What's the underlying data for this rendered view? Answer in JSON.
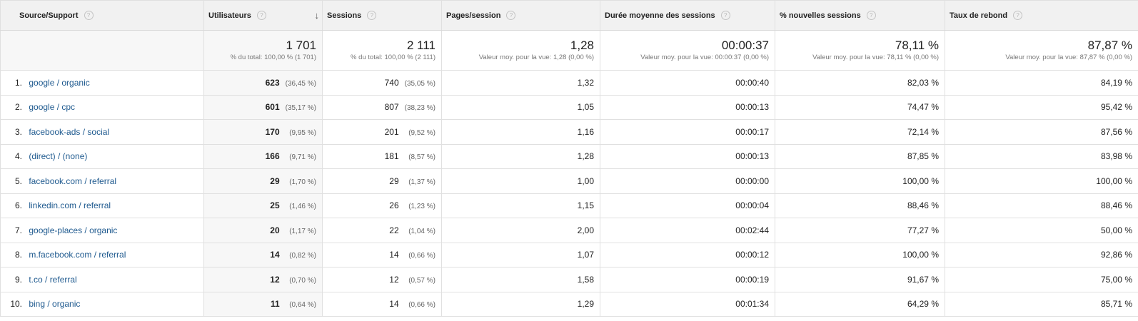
{
  "headers": {
    "source": "Source/Support",
    "users": "Utilisateurs",
    "sessions": "Sessions",
    "pages": "Pages/session",
    "duration": "Durée moyenne des sessions",
    "new_sessions": "% nouvelles sessions",
    "bounce": "Taux de rebond",
    "help_glyph": "?"
  },
  "totals": {
    "users": "1 701",
    "users_sub": "% du total: 100,00 % (1 701)",
    "sessions": "2 111",
    "sessions_sub": "% du total: 100,00 % (2 111)",
    "pages": "1,28",
    "pages_sub": "Valeur moy. pour la vue: 1,28 (0,00 %)",
    "duration": "00:00:37",
    "duration_sub": "Valeur moy. pour la vue: 00:00:37 (0,00 %)",
    "new_sessions": "78,11 %",
    "new_sessions_sub": "Valeur moy. pour la vue: 78,11 % (0,00 %)",
    "bounce": "87,87 %",
    "bounce_sub": "Valeur moy. pour la vue: 87,87 % (0,00 %)"
  },
  "rows": [
    {
      "idx": "1.",
      "source": "google / organic",
      "users": "623",
      "users_pct": "(36,45 %)",
      "sessions": "740",
      "sessions_pct": "(35,05 %)",
      "pages": "1,32",
      "duration": "00:00:40",
      "new_sessions": "82,03 %",
      "bounce": "84,19 %"
    },
    {
      "idx": "2.",
      "source": "google / cpc",
      "users": "601",
      "users_pct": "(35,17 %)",
      "sessions": "807",
      "sessions_pct": "(38,23 %)",
      "pages": "1,05",
      "duration": "00:00:13",
      "new_sessions": "74,47 %",
      "bounce": "95,42 %"
    },
    {
      "idx": "3.",
      "source": "facebook-ads / social",
      "users": "170",
      "users_pct": "(9,95 %)",
      "sessions": "201",
      "sessions_pct": "(9,52 %)",
      "pages": "1,16",
      "duration": "00:00:17",
      "new_sessions": "72,14 %",
      "bounce": "87,56 %"
    },
    {
      "idx": "4.",
      "source": "(direct) / (none)",
      "users": "166",
      "users_pct": "(9,71 %)",
      "sessions": "181",
      "sessions_pct": "(8,57 %)",
      "pages": "1,28",
      "duration": "00:00:13",
      "new_sessions": "87,85 %",
      "bounce": "83,98 %"
    },
    {
      "idx": "5.",
      "source": "facebook.com / referral",
      "users": "29",
      "users_pct": "(1,70 %)",
      "sessions": "29",
      "sessions_pct": "(1,37 %)",
      "pages": "1,00",
      "duration": "00:00:00",
      "new_sessions": "100,00 %",
      "bounce": "100,00 %"
    },
    {
      "idx": "6.",
      "source": "linkedin.com / referral",
      "users": "25",
      "users_pct": "(1,46 %)",
      "sessions": "26",
      "sessions_pct": "(1,23 %)",
      "pages": "1,15",
      "duration": "00:00:04",
      "new_sessions": "88,46 %",
      "bounce": "88,46 %"
    },
    {
      "idx": "7.",
      "source": "google-places / organic",
      "users": "20",
      "users_pct": "(1,17 %)",
      "sessions": "22",
      "sessions_pct": "(1,04 %)",
      "pages": "2,00",
      "duration": "00:02:44",
      "new_sessions": "77,27 %",
      "bounce": "50,00 %"
    },
    {
      "idx": "8.",
      "source": "m.facebook.com / referral",
      "users": "14",
      "users_pct": "(0,82 %)",
      "sessions": "14",
      "sessions_pct": "(0,66 %)",
      "pages": "1,07",
      "duration": "00:00:12",
      "new_sessions": "100,00 %",
      "bounce": "92,86 %"
    },
    {
      "idx": "9.",
      "source": "t.co / referral",
      "users": "12",
      "users_pct": "(0,70 %)",
      "sessions": "12",
      "sessions_pct": "(0,57 %)",
      "pages": "1,58",
      "duration": "00:00:19",
      "new_sessions": "91,67 %",
      "bounce": "75,00 %"
    },
    {
      "idx": "10.",
      "source": "bing / organic",
      "users": "11",
      "users_pct": "(0,64 %)",
      "sessions": "14",
      "sessions_pct": "(0,66 %)",
      "pages": "1,29",
      "duration": "00:01:34",
      "new_sessions": "64,29 %",
      "bounce": "85,71 %"
    }
  ],
  "colors": {
    "link": "#1f5a8f",
    "header_bg": "#f1f1f1",
    "shade": "#f7f7f7",
    "border": "#e0e0e0"
  },
  "icons": {
    "help": "help-icon",
    "sort": "sort-descending-arrow-icon"
  }
}
